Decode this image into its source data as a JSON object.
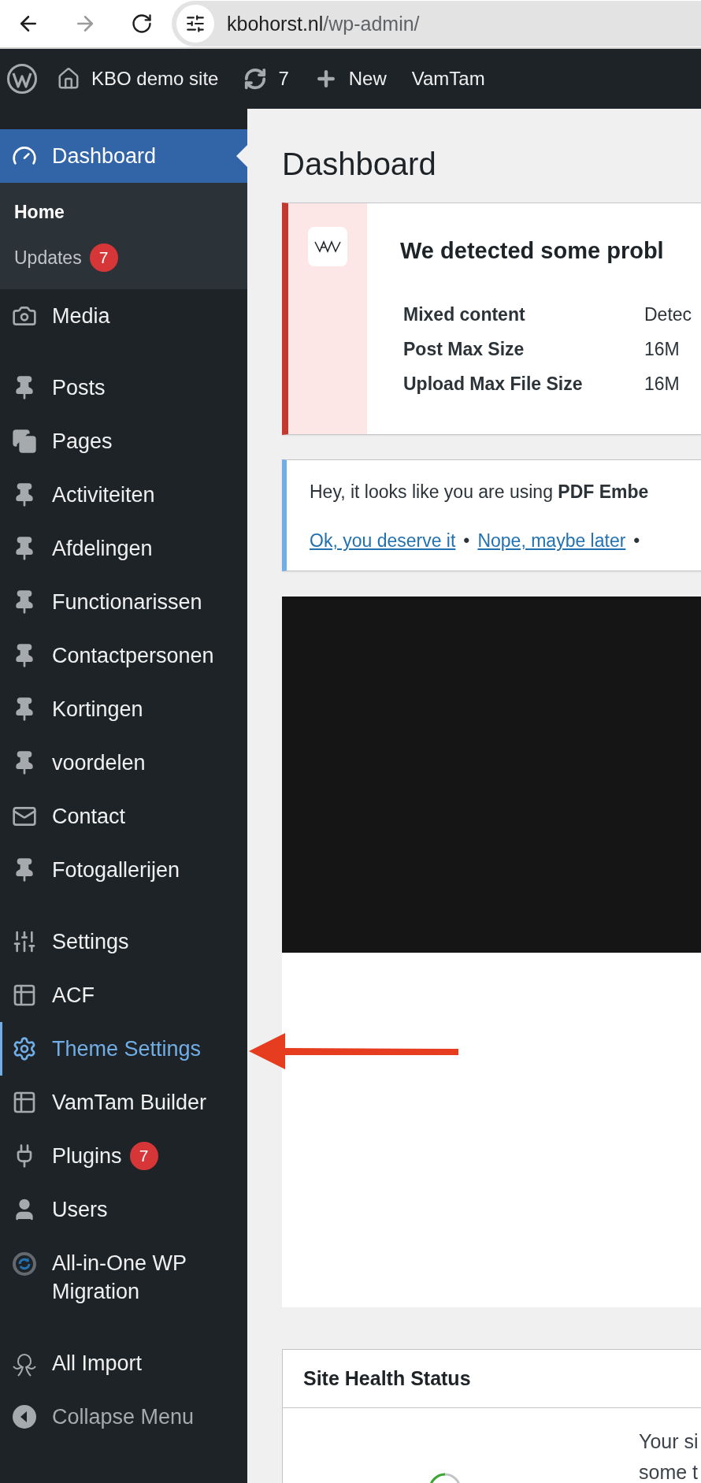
{
  "browser": {
    "url_host": "kbohorst.nl",
    "url_path": "/wp-admin/",
    "forward_disabled": true
  },
  "admin_bar": {
    "site_name": "KBO demo site",
    "updates_count": "7",
    "new_label": "New",
    "theme_label": "VamTam"
  },
  "sidebar": {
    "groups": [
      [
        {
          "kind": "menu",
          "label": "Dashboard",
          "selected": true,
          "highlighted": false,
          "children": [
            {
              "label": "Home",
              "selected": true
            },
            {
              "label": "Updates",
              "selected": false,
              "badge": "7"
            }
          ]
        },
        {
          "kind": "menu",
          "label": "Media",
          "selected": false,
          "highlighted": false
        }
      ],
      [
        {
          "kind": "menu",
          "label": "Posts",
          "selected": false,
          "highlighted": false
        },
        {
          "kind": "menu",
          "label": "Pages",
          "selected": false,
          "highlighted": false
        },
        {
          "kind": "menu",
          "label": "Activiteiten",
          "selected": false,
          "highlighted": false
        },
        {
          "kind": "menu",
          "label": "Afdelingen",
          "selected": false,
          "highlighted": false
        },
        {
          "kind": "menu",
          "label": "Functionarissen",
          "selected": false,
          "highlighted": false
        },
        {
          "kind": "menu",
          "label": "Contactpersonen",
          "selected": false,
          "highlighted": false
        },
        {
          "kind": "menu",
          "label": "Kortingen",
          "selected": false,
          "highlighted": false
        },
        {
          "kind": "menu",
          "label": "voordelen",
          "selected": false,
          "highlighted": false
        },
        {
          "kind": "menu",
          "label": "Contact",
          "selected": false,
          "highlighted": false
        },
        {
          "kind": "menu",
          "label": "Fotogallerijen",
          "selected": false,
          "highlighted": false
        }
      ],
      [
        {
          "kind": "menu",
          "label": "Settings",
          "selected": false,
          "highlighted": false
        },
        {
          "kind": "menu",
          "label": "ACF",
          "selected": false,
          "highlighted": false
        },
        {
          "kind": "menu",
          "label": "Theme Settings",
          "selected": false,
          "highlighted": true
        },
        {
          "kind": "menu",
          "label": "VamTam Builder",
          "selected": false,
          "highlighted": false
        },
        {
          "kind": "menu",
          "label": "Plugins",
          "selected": false,
          "highlighted": false,
          "badge": "7"
        },
        {
          "kind": "menu",
          "label": "Users",
          "selected": false,
          "highlighted": false
        },
        {
          "kind": "menu",
          "label": "All-in-One WP Migration",
          "selected": false,
          "highlighted": false
        }
      ],
      [
        {
          "kind": "menu",
          "label": "All Import",
          "selected": false,
          "highlighted": false
        },
        {
          "kind": "collapse",
          "label": "Collapse Menu",
          "selected": false,
          "highlighted": false
        }
      ]
    ]
  },
  "page_title": "Dashboard",
  "problem_notice": {
    "title": "We detected some probl",
    "rows": [
      {
        "label": "Mixed content",
        "value": "Detec"
      },
      {
        "label": "Post Max Size",
        "value": "16M"
      },
      {
        "label": "Upload Max File Size",
        "value": "16M"
      }
    ]
  },
  "review_notice": {
    "text": "Hey, it looks like you are using **PDF Embe**",
    "links": [
      "Ok, you deserve it",
      "Nope, maybe later"
    ],
    "separator": "•"
  },
  "site_health": {
    "title": "Site Health Status",
    "text_lines": [
      "Your si",
      "some t"
    ]
  },
  "annotation_arrow": {
    "color": "#e63c1f"
  }
}
